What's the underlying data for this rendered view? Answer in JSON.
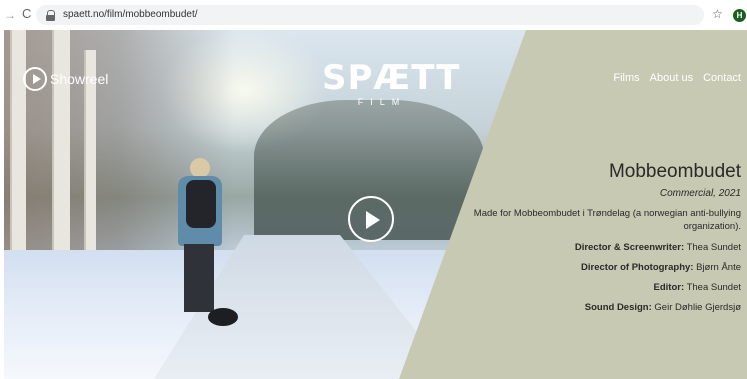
{
  "browser": {
    "url": "spaett.no/film/mobbeombudet/",
    "profile_initial": "H"
  },
  "header": {
    "showreel_label": "Showreel",
    "logo_main": "SPÆTT",
    "logo_sub": "FILM",
    "nav": [
      {
        "label": "Films"
      },
      {
        "label": "About us"
      },
      {
        "label": "Contact"
      }
    ]
  },
  "film": {
    "title": "Mobbeombudet",
    "meta": "Commercial, 2021",
    "description": "Made for Mobbeombudet i Trøndelag (a norwegian anti-bullying organization).",
    "credits": [
      {
        "role": "Director & Screenwriter:",
        "name": "Thea Sundet"
      },
      {
        "role": "Director of Photography:",
        "name": "Bjørn Ånte"
      },
      {
        "role": "Editor:",
        "name": "Thea Sundet"
      },
      {
        "role": "Sound Design:",
        "name": "Geir Døhlie Gjerdsjø"
      }
    ]
  },
  "colors": {
    "panel": "#c7c9b2",
    "text": "#2a2a2a"
  }
}
